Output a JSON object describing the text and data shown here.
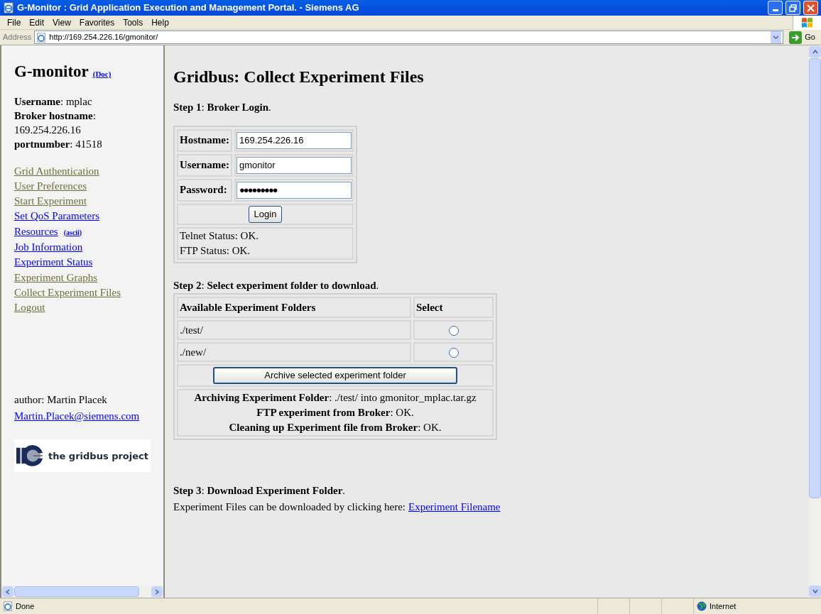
{
  "window": {
    "title": "G-Monitor : Grid Application Execution and Management Portal. - Siemens AG"
  },
  "menu": [
    "File",
    "Edit",
    "View",
    "Favorites",
    "Tools",
    "Help"
  ],
  "address_bar": {
    "label": "Address",
    "url": "http://169.254.226.16/gmonitor/",
    "go": "Go"
  },
  "sidebar": {
    "title": "G-monitor",
    "doc_link": "(Doc)",
    "info": [
      "**Username**: mplac",
      "**Broker hostname**:",
      "169.254.226.16",
      "**portnumber**: 41518"
    ],
    "links": [
      {
        "label": "Grid Authentication",
        "visited": true
      },
      {
        "label": "User Preferences",
        "visited": true
      },
      {
        "label": "Start Experiment",
        "visited": true
      },
      {
        "label": "Set QoS Parameters",
        "visited": false
      },
      {
        "label": "Resources",
        "visited": false,
        "extra": "(ascii)"
      },
      {
        "label": "Job Information",
        "visited": false
      },
      {
        "label": "Experiment Status",
        "visited": false
      },
      {
        "label": "Experiment Graphs",
        "visited": true
      },
      {
        "label": "Collect Experiment Files",
        "visited": true
      },
      {
        "label": "Logout",
        "visited": true
      }
    ],
    "author": "author: Martin Placek",
    "email": "Martin.Placek@siemens.com",
    "logo_text": "the gridbus project"
  },
  "main": {
    "title": "Gridbus: Collect Experiment Files",
    "step1": "**Step 1**: **Broker Login**.",
    "login_fields": [
      {
        "label": "Hostname:",
        "value": "169.254.226.16",
        "kind": "text"
      },
      {
        "label": "Username:",
        "value": "gmonitor",
        "kind": "text"
      },
      {
        "label": "Password:",
        "value": "●●●●●●●●●",
        "kind": "password"
      }
    ],
    "login_button": "Login",
    "login_status": [
      "Telnet Status: OK.",
      "FTP Status: OK."
    ],
    "step2": "**Step 2**: **Select experiment folder to download**.",
    "folders": {
      "columns": [
        "Available Experiment Folders",
        "Select"
      ],
      "rows": [
        {
          "folder": "./test/",
          "selected": false
        },
        {
          "folder": "./new/",
          "selected": false
        }
      ],
      "button": "Archive selected experiment folder",
      "messages": [
        "**Archiving Experiment Folder**: ./test/ into gmonitor_mplac.tar.gz",
        "**FTP experiment from Broker**: OK.",
        "**Cleaning up Experiment file from Broker**: OK."
      ]
    },
    "step3": "**Step 3**: **Download Experiment Folder**.",
    "download_text": "Experiment Files can be downloaded by clicking here:",
    "download_link": "Experiment Filename"
  },
  "status_bar": {
    "text": "Done",
    "zone": "Internet"
  }
}
